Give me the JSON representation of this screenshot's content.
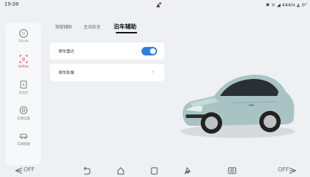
{
  "status": {
    "time": "19:08",
    "right_text": "✱ ᯤ ◢ 444m ◭ 0°"
  },
  "sidebar": {
    "items": [
      {
        "label": "DiLink",
        "icon": "dilink-icon",
        "active": false
      },
      {
        "label": "DiPilot",
        "icon": "dipilot-icon",
        "active": true
      },
      {
        "label": "车控灯",
        "icon": "vehicle-control-icon",
        "active": false
      },
      {
        "label": "车辆设置",
        "icon": "vehicle-settings-icon",
        "active": false
      },
      {
        "label": "车辆健康",
        "icon": "vehicle-health-icon",
        "active": false
      }
    ]
  },
  "tabs": [
    {
      "label": "驾驶辅助",
      "active": false
    },
    {
      "label": "主动安全",
      "active": false
    },
    {
      "label": "泊车辅助",
      "active": true
    }
  ],
  "settings": {
    "rear_radar": {
      "label": "倒车雷达",
      "enabled": true
    },
    "rear_camera": {
      "label": "倒车影像"
    }
  },
  "navbar": {
    "left_label": "OFF",
    "right_label": "OFF",
    "icons": [
      "back-icon",
      "home-icon",
      "recents-icon",
      "steering-wheel-icon",
      "camera-icon"
    ]
  },
  "colors": {
    "accent_red": "#e03a3a",
    "toggle_blue": "#2f7fe0",
    "car_body": "#a9c3c4"
  }
}
